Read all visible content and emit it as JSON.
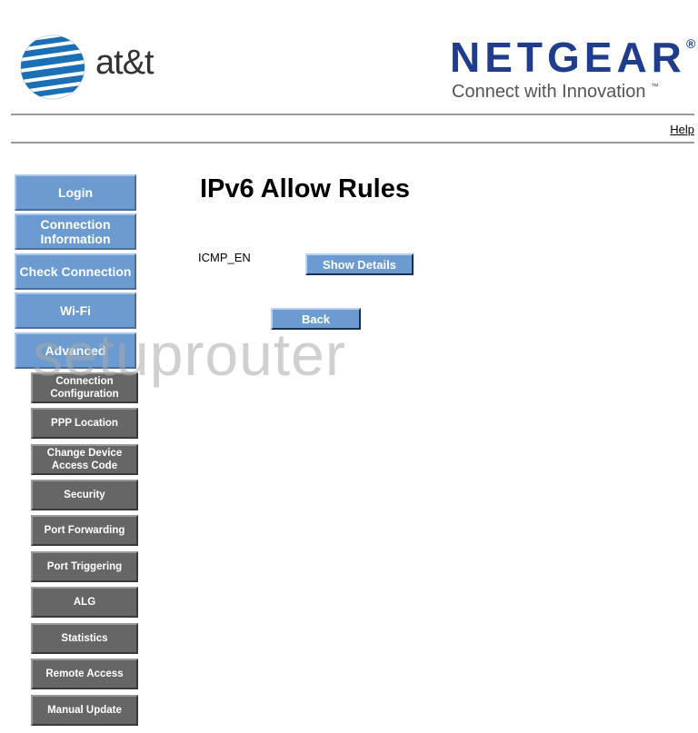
{
  "header": {
    "att_logo_text": "at&t",
    "netgear_wordmark": "NETGEAR",
    "netgear_registered": "®",
    "netgear_tagline": "Connect with Innovation",
    "netgear_tm": "™",
    "help_label": "Help"
  },
  "nav": {
    "main": [
      {
        "label": "Login"
      },
      {
        "label": "Connection Information"
      },
      {
        "label": "Check Connection"
      },
      {
        "label": "Wi-Fi"
      },
      {
        "label": "Advanced"
      }
    ],
    "advanced_sub": [
      {
        "label": "Connection Configuration"
      },
      {
        "label": "PPP Location"
      },
      {
        "label": "Change Device Access Code"
      },
      {
        "label": "Security"
      },
      {
        "label": "Port Forwarding"
      },
      {
        "label": "Port Triggering"
      },
      {
        "label": "ALG"
      },
      {
        "label": "Statistics"
      },
      {
        "label": "Remote Access"
      },
      {
        "label": "Manual Update"
      }
    ]
  },
  "watermark": "setuprouter",
  "main": {
    "title": "IPv6 Allow Rules",
    "rule_name": "ICMP_EN",
    "show_details_label": "Show Details",
    "back_label": "Back"
  },
  "colors": {
    "main_nav_blue": "#6b9bd1",
    "sub_nav_gray": "#666666",
    "netgear_blue": "#1f3d8c"
  }
}
